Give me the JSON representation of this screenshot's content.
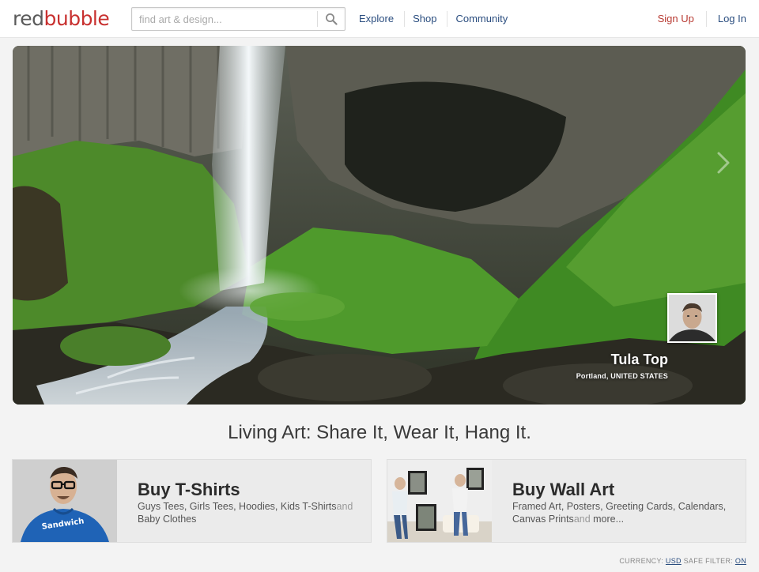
{
  "header": {
    "logo_left": "red",
    "logo_right": "bubble",
    "search_placeholder": "find art & design...",
    "nav": [
      "Explore",
      "Shop",
      "Community"
    ],
    "signup": "Sign Up",
    "login": "Log In"
  },
  "hero": {
    "artist_name": "Tula Top",
    "artist_location": "Portland, UNITED STATES"
  },
  "tagline": "Living Art: Share It, Wear It, Hang It.",
  "cards": {
    "tshirts": {
      "title": "Buy T-Shirts",
      "desc_part1": "Guys Tees, Girls Tees, Hoodies, Kids T-Shirts",
      "desc_and": "and",
      "desc_part2": " Baby Clothes",
      "shirt_text": "Sandwich"
    },
    "wallart": {
      "title": "Buy Wall Art",
      "desc_part1": "Framed Art, Posters, Greeting Cards, Calendars, Canvas Prints",
      "desc_and": "and",
      "desc_part2": " more..."
    }
  },
  "footer": {
    "currency_label": "CURRENCY:",
    "currency_value": "USD",
    "filter_label": "SAFE FILTER:",
    "filter_value": "ON"
  },
  "colors": {
    "brand_red": "#c8302f",
    "link_blue": "#2a4d7f",
    "background": "#f3f3f3"
  }
}
